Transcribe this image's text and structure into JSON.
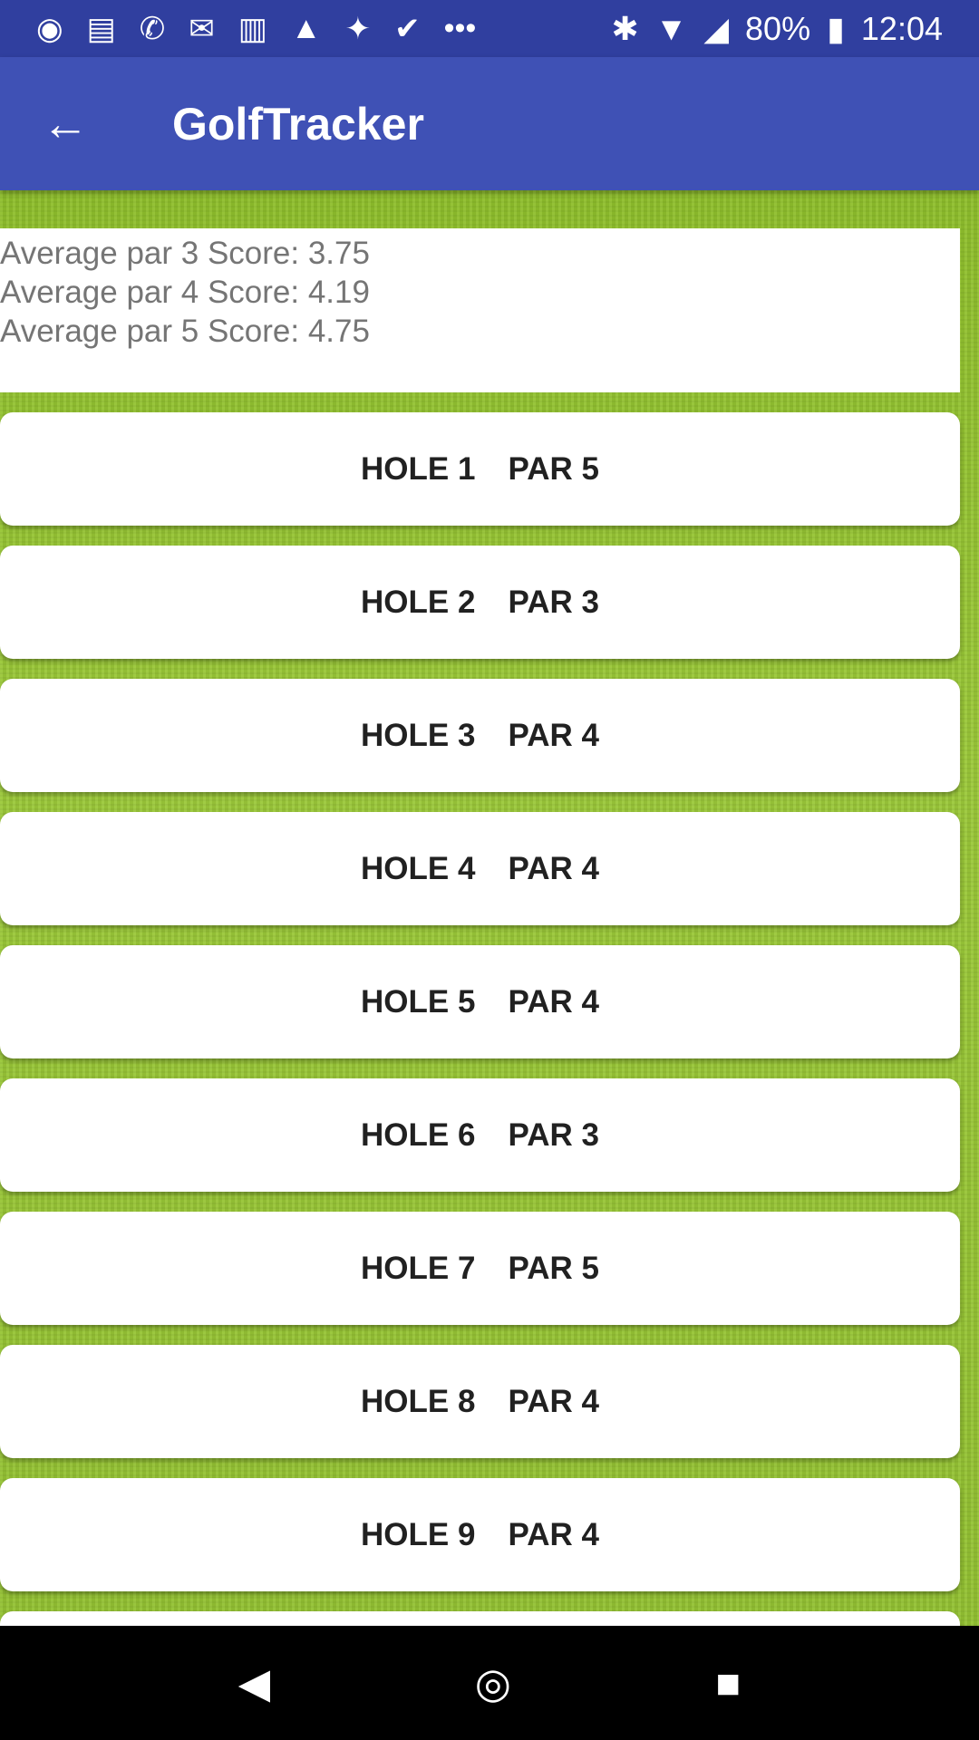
{
  "status_bar": {
    "notification_icons": [
      "spotify-icon",
      "news-icon",
      "whatsapp-icon",
      "mail-icon",
      "gmail-icon",
      "photo-icon",
      "twitter-icon",
      "check-icon",
      "more-icon"
    ],
    "battery": "80%",
    "time": "12:04"
  },
  "app_bar": {
    "title": "GolfTracker",
    "back_icon": "arrow-left-icon"
  },
  "stats": [
    "Average par 3 Score: 3.75",
    "Average par 4 Score: 4.19",
    "Average par 5 Score: 4.75"
  ],
  "holes": [
    {
      "hole": "HOLE 1",
      "par": "PAR 5"
    },
    {
      "hole": "HOLE 2",
      "par": "PAR 3"
    },
    {
      "hole": "HOLE 3",
      "par": "PAR 4"
    },
    {
      "hole": "HOLE 4",
      "par": "PAR 4"
    },
    {
      "hole": "HOLE 5",
      "par": "PAR 4"
    },
    {
      "hole": "HOLE 6",
      "par": "PAR 3"
    },
    {
      "hole": "HOLE 7",
      "par": "PAR 5"
    },
    {
      "hole": "HOLE 8",
      "par": "PAR 4"
    },
    {
      "hole": "HOLE 9",
      "par": "PAR 4"
    }
  ],
  "colors": {
    "status_bar": "#303f9f",
    "app_bar": "#3f51b5",
    "grass": "#94c233"
  }
}
